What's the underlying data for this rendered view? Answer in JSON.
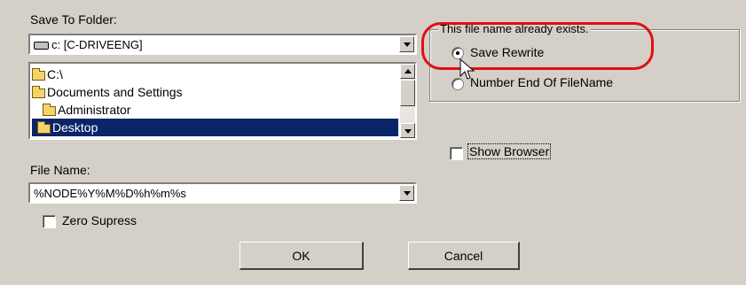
{
  "save_to_folder": {
    "label": "Save To Folder:",
    "drive_value": "c: [C-DRIVEENG]",
    "tree": [
      {
        "label": "C:\\",
        "icon": "open-folder-icon"
      },
      {
        "label": "Documents and Settings",
        "icon": "open-folder-icon"
      },
      {
        "label": "Administrator",
        "icon": "open-folder-icon"
      },
      {
        "label": "Desktop",
        "icon": "folder-icon",
        "selected": true
      }
    ]
  },
  "file_name": {
    "label": "File Name:",
    "value": "%NODE%Y%M%D%h%m%s"
  },
  "zero_supress": {
    "label": "Zero Supress",
    "checked": false
  },
  "exists_group": {
    "title": "This file name already exists.",
    "options": [
      {
        "label": "Save Rewrite",
        "selected": true
      },
      {
        "label": "Number End Of FileName",
        "selected": false
      }
    ]
  },
  "show_browser": {
    "label": "Show Browser",
    "checked": false
  },
  "buttons": {
    "ok": "OK",
    "cancel": "Cancel"
  },
  "colors": {
    "highlight": "#e01010",
    "selection": "#0a246a",
    "face": "#d4d0c8"
  }
}
